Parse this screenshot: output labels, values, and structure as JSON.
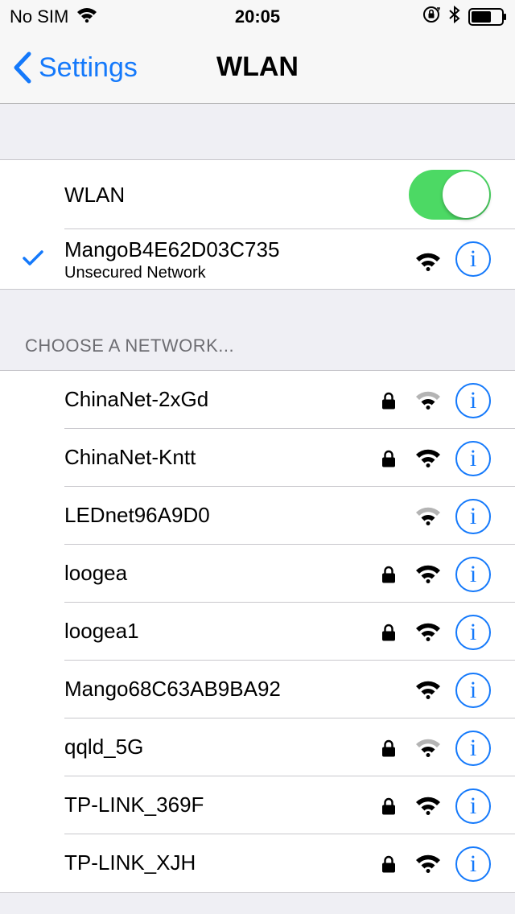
{
  "status_bar": {
    "carrier": "No SIM",
    "time": "20:05"
  },
  "nav": {
    "back_label": "Settings",
    "title": "WLAN"
  },
  "wlan": {
    "label": "WLAN",
    "enabled": true,
    "toggle_color": "#4cd964"
  },
  "connected": {
    "name": "MangoB4E62D03C735",
    "subtitle": "Unsecured Network",
    "signal": "full"
  },
  "section_header": "CHOOSE A NETWORK...",
  "networks": [
    {
      "name": "ChinaNet-2xGd",
      "locked": true,
      "signal": "weak"
    },
    {
      "name": "ChinaNet-Kntt",
      "locked": true,
      "signal": "full"
    },
    {
      "name": "LEDnet96A9D0",
      "locked": false,
      "signal": "weak"
    },
    {
      "name": "loogea",
      "locked": true,
      "signal": "full"
    },
    {
      "name": "loogea1",
      "locked": true,
      "signal": "full"
    },
    {
      "name": "Mango68C63AB9BA92",
      "locked": false,
      "signal": "full"
    },
    {
      "name": "qqld_5G",
      "locked": true,
      "signal": "weak"
    },
    {
      "name": "TP-LINK_369F",
      "locked": true,
      "signal": "full"
    },
    {
      "name": "TP-LINK_XJH",
      "locked": true,
      "signal": "full"
    }
  ],
  "colors": {
    "accent": "#1479fb",
    "background": "#efeff4",
    "weak_signal": "#b4b4b4"
  }
}
